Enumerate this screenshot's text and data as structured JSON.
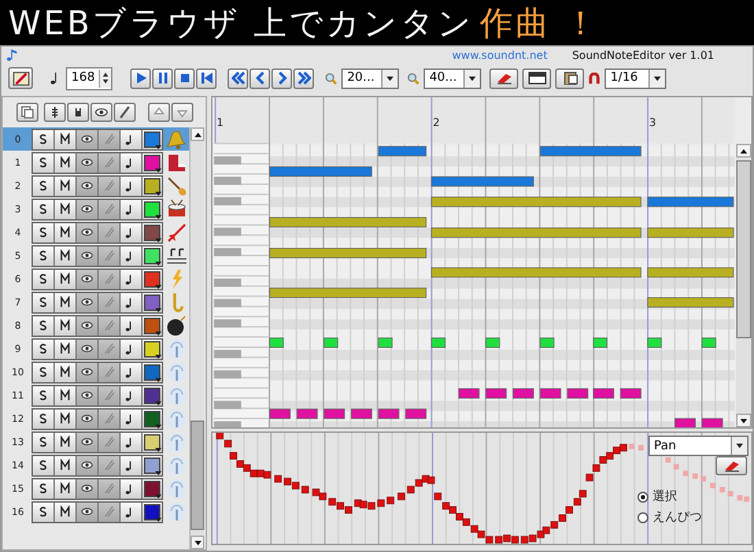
{
  "title": {
    "text": "WEBブラウザ 上でカンタン",
    "accent": "作曲 ！"
  },
  "header": {
    "link": "www.soundnt.net",
    "version": "SoundNoteEditor ver 1.01"
  },
  "toolbar": {
    "tempo": "168",
    "zoom_horizontal": "20...",
    "zoom_vertical": "40...",
    "snap": "1/16"
  },
  "tracks": [
    {
      "number": "0",
      "color": "#1a78d8",
      "selected": true
    },
    {
      "number": "1",
      "color": "#e010a0",
      "selected": false
    },
    {
      "number": "2",
      "color": "#b8b020",
      "selected": false
    },
    {
      "number": "3",
      "color": "#20e040",
      "selected": false
    },
    {
      "number": "4",
      "color": "#804848",
      "selected": false
    },
    {
      "number": "5",
      "color": "#40e060",
      "selected": false
    },
    {
      "number": "6",
      "color": "#e03020",
      "selected": false
    },
    {
      "number": "7",
      "color": "#8060c0",
      "selected": false
    },
    {
      "number": "8",
      "color": "#c05010",
      "selected": false
    },
    {
      "number": "9",
      "color": "#d8d020",
      "selected": false
    },
    {
      "number": "10",
      "color": "#1068c0",
      "selected": false
    },
    {
      "number": "11",
      "color": "#503090",
      "selected": false
    },
    {
      "number": "12",
      "color": "#106020",
      "selected": false
    },
    {
      "number": "13",
      "color": "#d8d070",
      "selected": false
    },
    {
      "number": "14",
      "color": "#90a0d0",
      "selected": false
    },
    {
      "number": "15",
      "color": "#801030",
      "selected": false
    },
    {
      "number": "16",
      "color": "#1010c0",
      "selected": false
    }
  ],
  "piano_roll": {
    "measures": [
      "1",
      "2",
      "3"
    ]
  },
  "controller": {
    "parameter": "Pan",
    "modes": [
      {
        "label": "選択",
        "selected": true
      },
      {
        "label": "えんぴつ",
        "selected": false
      }
    ]
  }
}
